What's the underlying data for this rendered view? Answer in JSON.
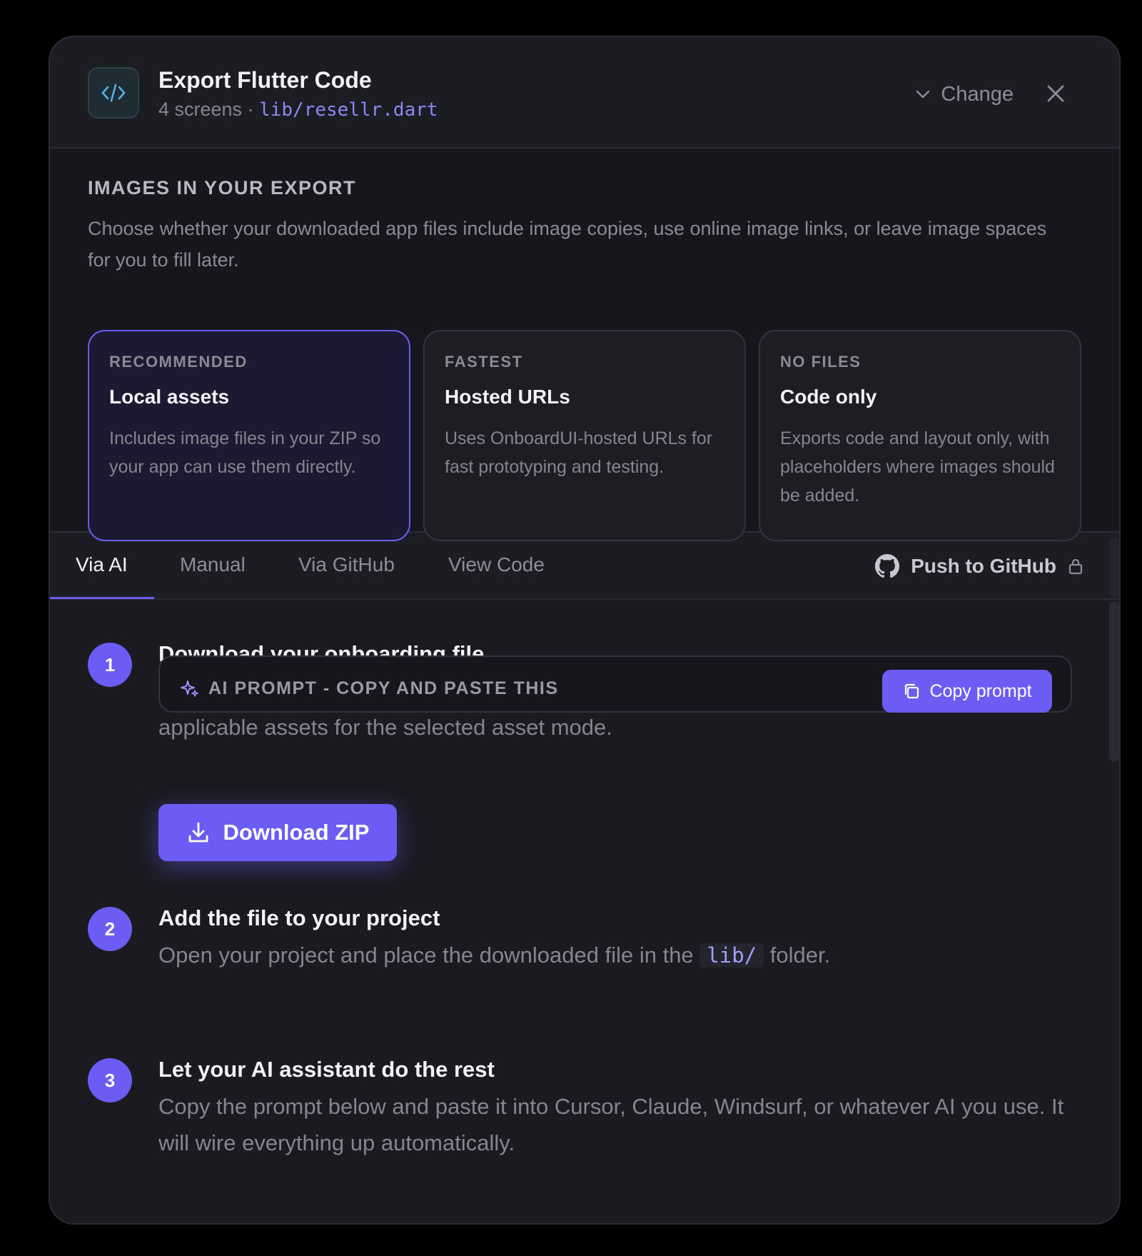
{
  "header": {
    "title": "Export Flutter Code",
    "screens": "4 screens ·",
    "path": "lib/resellr.dart",
    "change_label": "Change"
  },
  "images": {
    "label": "IMAGES IN YOUR EXPORT",
    "description": "Choose whether your downloaded app files include image copies, use online image links, or leave image spaces for you to fill later.",
    "options": [
      {
        "tag": "RECOMMENDED",
        "title": "Local assets",
        "description": "Includes image files in your ZIP so your app can use them directly.",
        "selected": true
      },
      {
        "tag": "FASTEST",
        "title": "Hosted URLs",
        "description": "Uses OnboardUI-hosted URLs for fast prototyping and testing.",
        "selected": false
      },
      {
        "tag": "NO FILES",
        "title": "Code only",
        "description": "Exports code and layout only, with placeholders where images should be added.",
        "selected": false
      }
    ]
  },
  "tabs": [
    {
      "label": "Via AI",
      "active": true
    },
    {
      "label": "Manual",
      "active": false
    },
    {
      "label": "Via GitHub",
      "active": false
    },
    {
      "label": "View Code",
      "active": false
    }
  ],
  "push_github_label": "Push to GitHub",
  "steps": [
    {
      "number": "1",
      "title": "Download your onboarding file",
      "description": "Download a ZIP package containing your onboarding code, setup instructions, and any applicable assets for the selected asset mode.",
      "button_label": "Download ZIP"
    },
    {
      "number": "2",
      "title": "Add the file to your project",
      "description_before": "Open your project and place the downloaded file in the",
      "code": "lib/",
      "description_after": "folder."
    },
    {
      "number": "3",
      "title": "Let your AI assistant do the rest",
      "description": "Copy the prompt below and paste it into Cursor, Claude, Windsurf, or whatever AI you use. It will wire everything up automatically."
    }
  ],
  "prompt": {
    "label": "AI PROMPT - COPY AND PASTE THIS",
    "copy_label": "Copy prompt"
  },
  "colors": {
    "accent": "#6b5df4",
    "background": "#1c1c23",
    "code": "#8f86f5"
  }
}
